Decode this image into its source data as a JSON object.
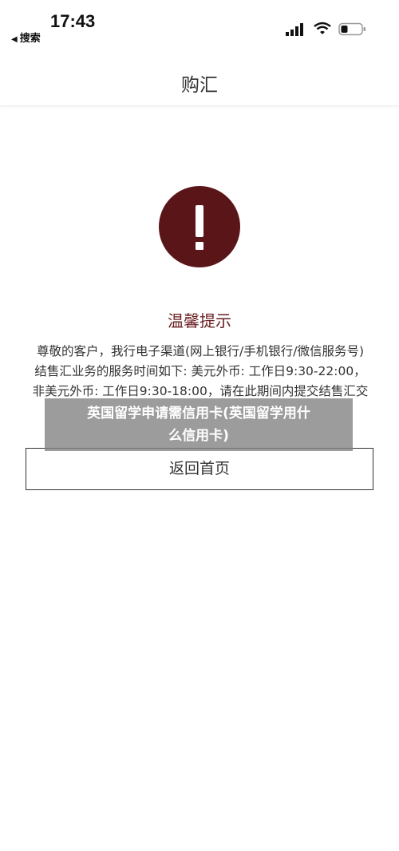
{
  "status_bar": {
    "time": "17:43",
    "back_app_label": "搜索",
    "icons": [
      "signal-icon",
      "wifi-icon",
      "battery-icon"
    ]
  },
  "nav": {
    "title": "购汇"
  },
  "notice": {
    "icon": "alert-icon",
    "icon_color": "#5a1519",
    "title": "温馨提示",
    "title_color": "#6b1e22",
    "lines": [
      "尊敬的客户，我行电子渠道(网上银行/手机银行/微信服务号)",
      "结售汇业务的服务时间如下: 美元外币: 工作日9:30-22:00，",
      "非美元外币: 工作日9:30-18:00，请在此期间内提交结售汇交"
    ]
  },
  "overlay": {
    "line1": "英国留学申请需信用卡(英国留学用什",
    "line2": "么信用卡)"
  },
  "home_button": {
    "label": "返回首页"
  }
}
